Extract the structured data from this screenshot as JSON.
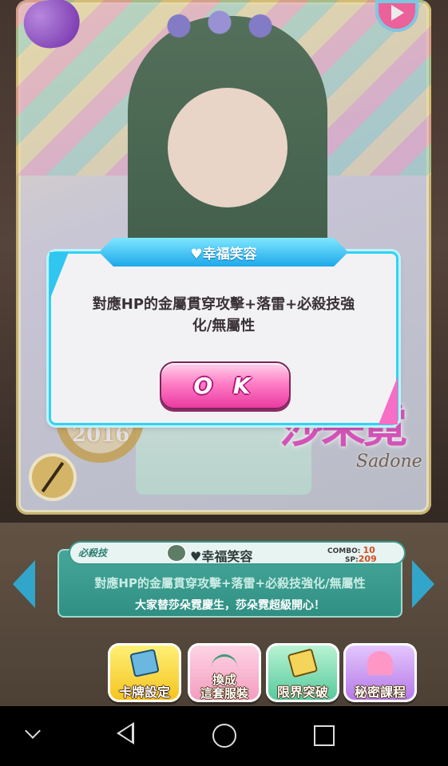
{
  "modal": {
    "title": "♥幸福笑容",
    "body_line1": "對應HP的金屬貫穿攻擊+落雷+必殺技強",
    "body_line2": "化/無屬性",
    "ok_label": "O K"
  },
  "card": {
    "name_cn": "莎朵霓",
    "name_en": "Sadone",
    "year": "2016"
  },
  "skill": {
    "tag": "必殺技",
    "name": "♥幸福笑容",
    "combo_label": "COMBO:",
    "combo_value": "10",
    "sp_label": "SP:",
    "sp_value": "209",
    "effect": "對應HP的金屬貫穿攻擊+落雷+必殺技強化/無屬性",
    "description": "大家替莎朵霓慶生，莎朵霓超級開心！"
  },
  "buttons": {
    "card_settings": "卡牌設定",
    "change_outfit_line1": "換成",
    "change_outfit_line2": "這套服裝",
    "limit_break": "限界突破",
    "secret_lesson": "秘密課程"
  },
  "icons": {
    "nav_down": "chevron-down-icon",
    "nav_back": "back-triangle-icon",
    "nav_home": "home-circle-icon",
    "nav_recent": "recent-square-icon"
  }
}
